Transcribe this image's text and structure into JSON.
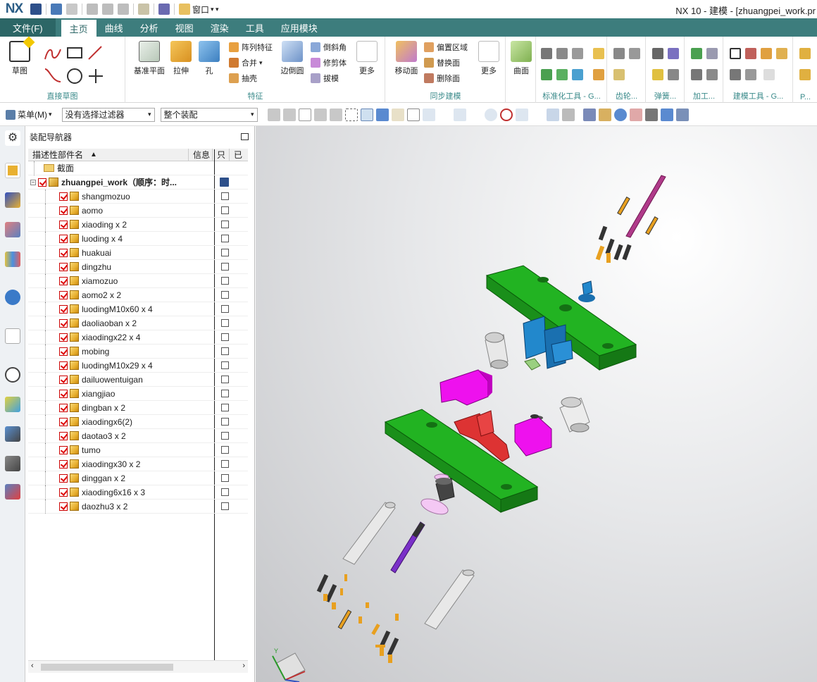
{
  "app": {
    "logo": "NX",
    "window_title": "NX 10 - 建模 - [zhuangpei_work.pr",
    "qat_window_label": "窗口"
  },
  "tabs": [
    "文件(F)",
    "主页",
    "曲线",
    "分析",
    "视图",
    "渲染",
    "工具",
    "应用模块"
  ],
  "active_tab": "主页",
  "ribbon": {
    "groups": {
      "sketch": "直接草图",
      "feature": "特征",
      "sync": "同步建模",
      "standard": "标准化工具 - G...",
      "gear": "齿轮...",
      "spring": "弹簧...",
      "machining": "加工...",
      "modeling_tools": "建模工具 - G...",
      "p": "P..."
    },
    "buttons": {
      "sketch": "草图",
      "datum_plane": "基准平面",
      "extrude": "拉伸",
      "hole": "孔",
      "pattern_feature": "阵列特征",
      "unite": "合并",
      "shell": "抽壳",
      "edge_blend": "边倒圆",
      "chamfer": "倒斜角",
      "trim_body": "修剪体",
      "draft": "拔模",
      "more1": "更多",
      "move_face": "移动面",
      "offset_region": "偏置区域",
      "replace_face": "替换面",
      "delete_face": "删除面",
      "more2": "更多",
      "surface": "曲面"
    }
  },
  "cmdbar": {
    "menu": "菜单(M)",
    "filter": "没有选择过滤器",
    "scope": "整个装配"
  },
  "navigator": {
    "title": "装配导航器",
    "columns": {
      "name": "描述性部件名",
      "info": "信息",
      "only": "只",
      "done": "已"
    },
    "section_folder": "截面",
    "root": "zhuangpei_work（顺序：时...",
    "items": [
      "shangmozuo",
      "aomo",
      "xiaoding x 2",
      "luoding x 4",
      "huakuai",
      "dingzhu",
      "xiamozuo",
      "aomo2 x 2",
      "luodingM10x60 x 4",
      "daoliaoban x 2",
      "xiaodingx22 x 4",
      "mobing",
      "luodingM10x29 x 4",
      "dailuowentuigan",
      "xiangjiao",
      "dingban x 2",
      "xiaodingx6(2)",
      "daotao3 x 2",
      "tumo",
      "xiaodingx30 x 2",
      "dinggan x 2",
      "xiaoding6x16 x 3",
      "daozhu3 x 2"
    ]
  },
  "colors": {
    "accent": "#3d7d7d",
    "plate": "#22b322",
    "punch": "#ee11ee",
    "slider": "#dd3333",
    "die_block": "#2288cc"
  },
  "triad_label": "Y"
}
